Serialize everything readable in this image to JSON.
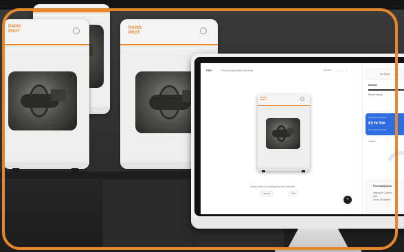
{
  "scene": {
    "accent_color": "#e8862c",
    "background_color": "#2f2f30"
  },
  "machines": [
    {
      "brand": "RAPID\nPROT",
      "has_window": true
    },
    {
      "brand": "RAPID\nPROT",
      "has_window": true
    },
    {
      "brand": "RAPID\nPROT",
      "has_window": true
    }
  ],
  "screen": {
    "header": {
      "title": "PRO",
      "subtitle": "Printer/Laser/Mill Machine",
      "status": "Camera"
    },
    "preview_caption": "Design input on making new bot controller",
    "buttons": {
      "left": "Upload",
      "right": "Edit"
    },
    "fab_icon": "plus-icon",
    "right_panel": {
      "user_label": "Jim Baker",
      "metric_title": "Network",
      "metric_caption": "Recent activity",
      "blue_card": {
        "title": "Machines operating",
        "value": "83 hr 5m",
        "caption": "Running time today"
      },
      "gauge_label": "Overall",
      "processing_title": "Processing queue",
      "processing_lines": [
        "Waiting for 2 jobs to",
        "start",
        "Check 3D printers"
      ]
    }
  }
}
